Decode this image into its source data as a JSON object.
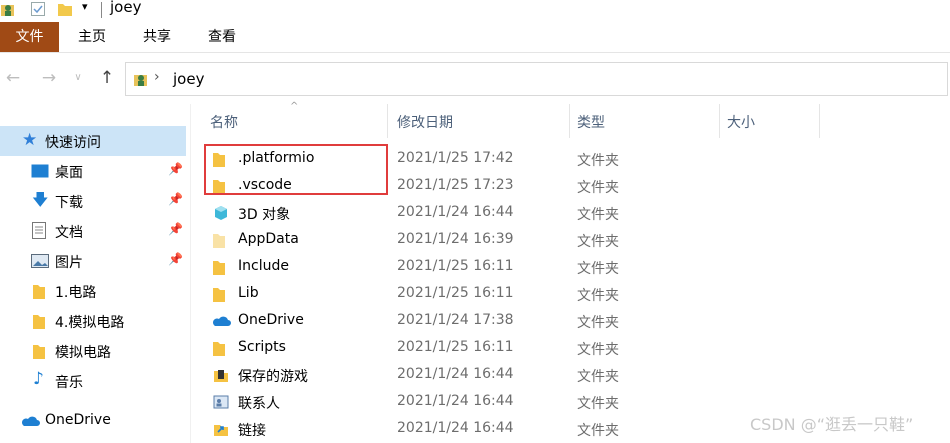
{
  "window": {
    "title": "joey"
  },
  "ribbon": {
    "tabs": [
      "文件",
      "主页",
      "共享",
      "查看"
    ]
  },
  "address": {
    "path_text": "joey",
    "separator": "›"
  },
  "sidebar": {
    "quick_access": "快速访问",
    "items": [
      {
        "label": "桌面",
        "pinned": true,
        "icon": "desktop-icon"
      },
      {
        "label": "下载",
        "pinned": true,
        "icon": "download-icon"
      },
      {
        "label": "文档",
        "pinned": true,
        "icon": "document-icon"
      },
      {
        "label": "图片",
        "pinned": true,
        "icon": "picture-icon"
      },
      {
        "label": "1.电路",
        "pinned": false,
        "icon": "folder-icon"
      },
      {
        "label": "4.模拟电路",
        "pinned": false,
        "icon": "folder-icon"
      },
      {
        "label": "模拟电路",
        "pinned": false,
        "icon": "folder-icon"
      },
      {
        "label": "音乐",
        "pinned": false,
        "icon": "music-icon"
      }
    ],
    "onedrive": "OneDrive"
  },
  "columns": {
    "name": "名称",
    "modified": "修改日期",
    "type": "类型",
    "size": "大小"
  },
  "files": [
    {
      "name": ".platformio",
      "date": "2021/1/25 17:42",
      "type": "文件夹",
      "icon": "folder-icon"
    },
    {
      "name": ".vscode",
      "date": "2021/1/25 17:23",
      "type": "文件夹",
      "icon": "folder-icon"
    },
    {
      "name": "3D 对象",
      "date": "2021/1/24 16:44",
      "type": "文件夹",
      "icon": "3d-objects-icon"
    },
    {
      "name": "AppData",
      "date": "2021/1/24 16:39",
      "type": "文件夹",
      "icon": "folder-hidden-icon"
    },
    {
      "name": "Include",
      "date": "2021/1/25 16:11",
      "type": "文件夹",
      "icon": "folder-icon"
    },
    {
      "name": "Lib",
      "date": "2021/1/25 16:11",
      "type": "文件夹",
      "icon": "folder-icon"
    },
    {
      "name": "OneDrive",
      "date": "2021/1/24 17:38",
      "type": "文件夹",
      "icon": "onedrive-icon"
    },
    {
      "name": "Scripts",
      "date": "2021/1/25 16:11",
      "type": "文件夹",
      "icon": "folder-icon"
    },
    {
      "name": "保存的游戏",
      "date": "2021/1/24 16:44",
      "type": "文件夹",
      "icon": "saved-games-icon"
    },
    {
      "name": "联系人",
      "date": "2021/1/24 16:44",
      "type": "文件夹",
      "icon": "contacts-icon"
    },
    {
      "name": "链接",
      "date": "2021/1/24 16:44",
      "type": "文件夹",
      "icon": "links-icon"
    }
  ],
  "watermark": "CSDN @“逛丢一只鞋”",
  "colors": {
    "file_tab": "#a04a15",
    "highlight": "#e03c3c",
    "selected": "#cce4f7"
  }
}
